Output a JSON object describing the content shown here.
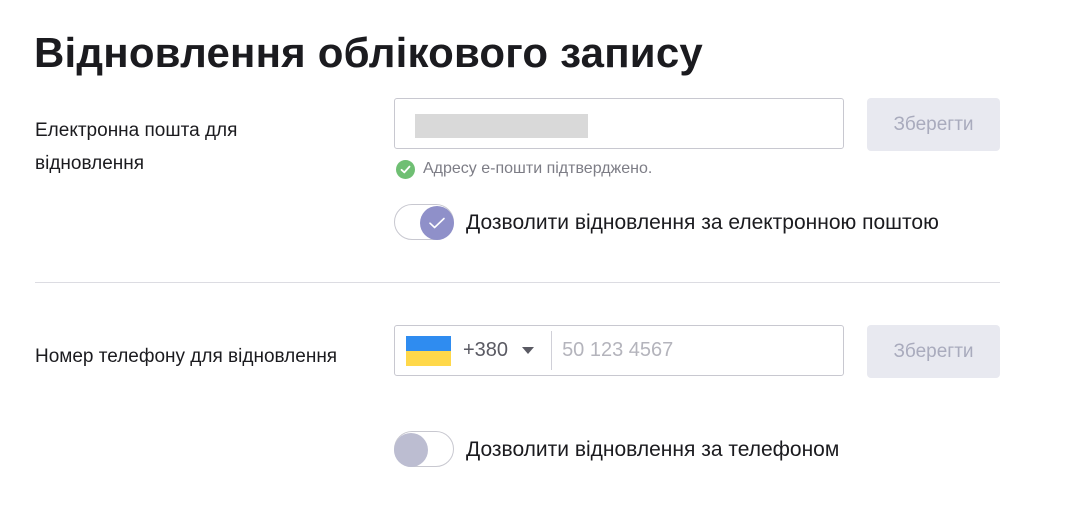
{
  "page": {
    "title": "Відновлення облікового запису"
  },
  "email_section": {
    "label": "Електронна пошта для відновлення",
    "input_value": "",
    "save_label": "Зберегти",
    "verified_text": "Адресу е-пошти підтверджено.",
    "toggle_label": "Дозволити відновлення за електронною поштою",
    "toggle_on": true
  },
  "phone_section": {
    "label": "Номер телефону для відновлення",
    "country": "Ukraine",
    "dial_code": "+380",
    "placeholder": "50 123 4567",
    "save_label": "Зберегти",
    "toggle_label": "Дозволити відновлення за телефоном",
    "toggle_on": false
  },
  "colors": {
    "toggle_on_knob": "#8f90c9",
    "toggle_off_knob": "#bcbdd1",
    "verified_green": "#6fbf73",
    "button_disabled_bg": "#e8e9f0",
    "button_disabled_text": "#a9abbd"
  },
  "icons": {
    "verified": "check-circle-icon",
    "toggle_check": "check-icon",
    "dropdown": "chevron-down-icon",
    "flag": "ukraine-flag-icon"
  }
}
